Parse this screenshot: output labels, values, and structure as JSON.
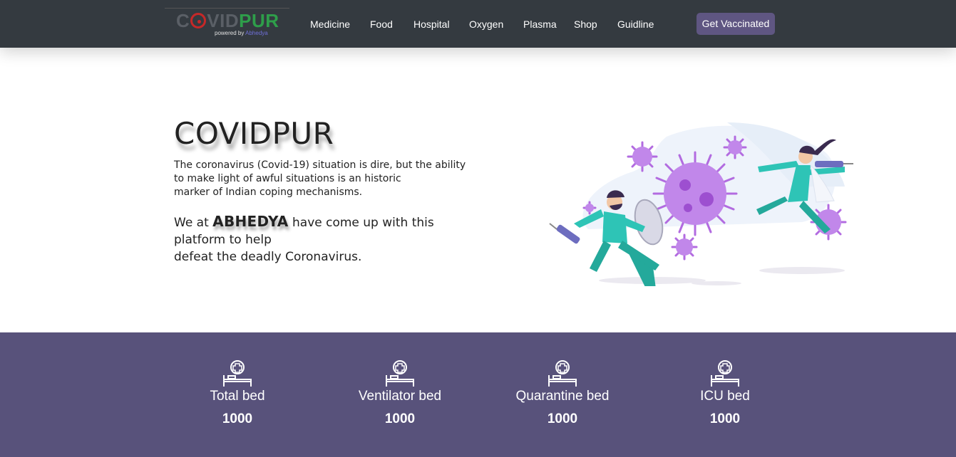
{
  "brand": {
    "logo_prefix": "C",
    "logo_covid_rest": "VID",
    "logo_pur": "PUR",
    "logo_sub_prefix": "powered by ",
    "logo_sub_brand": "Abhedya"
  },
  "nav": {
    "links": [
      "Medicine",
      "Food",
      "Hospital",
      "Oxygen",
      "Plasma",
      "Shop",
      "Guidline"
    ],
    "cta": "Get Vaccinated"
  },
  "hero": {
    "title": "COVIDPUR",
    "desc_lines": [
      "The coronavirus (Covid-19) situation is dire, but the ability",
      "to make light of awful situations is an historic",
      "marker of Indian coping mechanisms."
    ],
    "cta_before": "We at ",
    "cta_brand": "ABHEDYA",
    "cta_after": " have come up with this",
    "cta_line2": "platform to help",
    "cta_line3": "defeat the deadly Coronavirus."
  },
  "stats": [
    {
      "label": "Total bed",
      "value": "1000",
      "icon": "hospital-bed-icon"
    },
    {
      "label": "Ventilator bed",
      "value": "1000",
      "icon": "hospital-bed-icon"
    },
    {
      "label": "Quarantine bed",
      "value": "1000",
      "icon": "hospital-bed-icon"
    },
    {
      "label": "ICU bed",
      "value": "1000",
      "icon": "hospital-bed-icon"
    }
  ],
  "colors": {
    "navbar": "#343a40",
    "accent": "#5f5682",
    "stats_band": "#58527b",
    "logo_red": "#c62828",
    "logo_green": "#2e9e4a",
    "virus": "#b26be0",
    "medic": "#2ec4b6"
  }
}
